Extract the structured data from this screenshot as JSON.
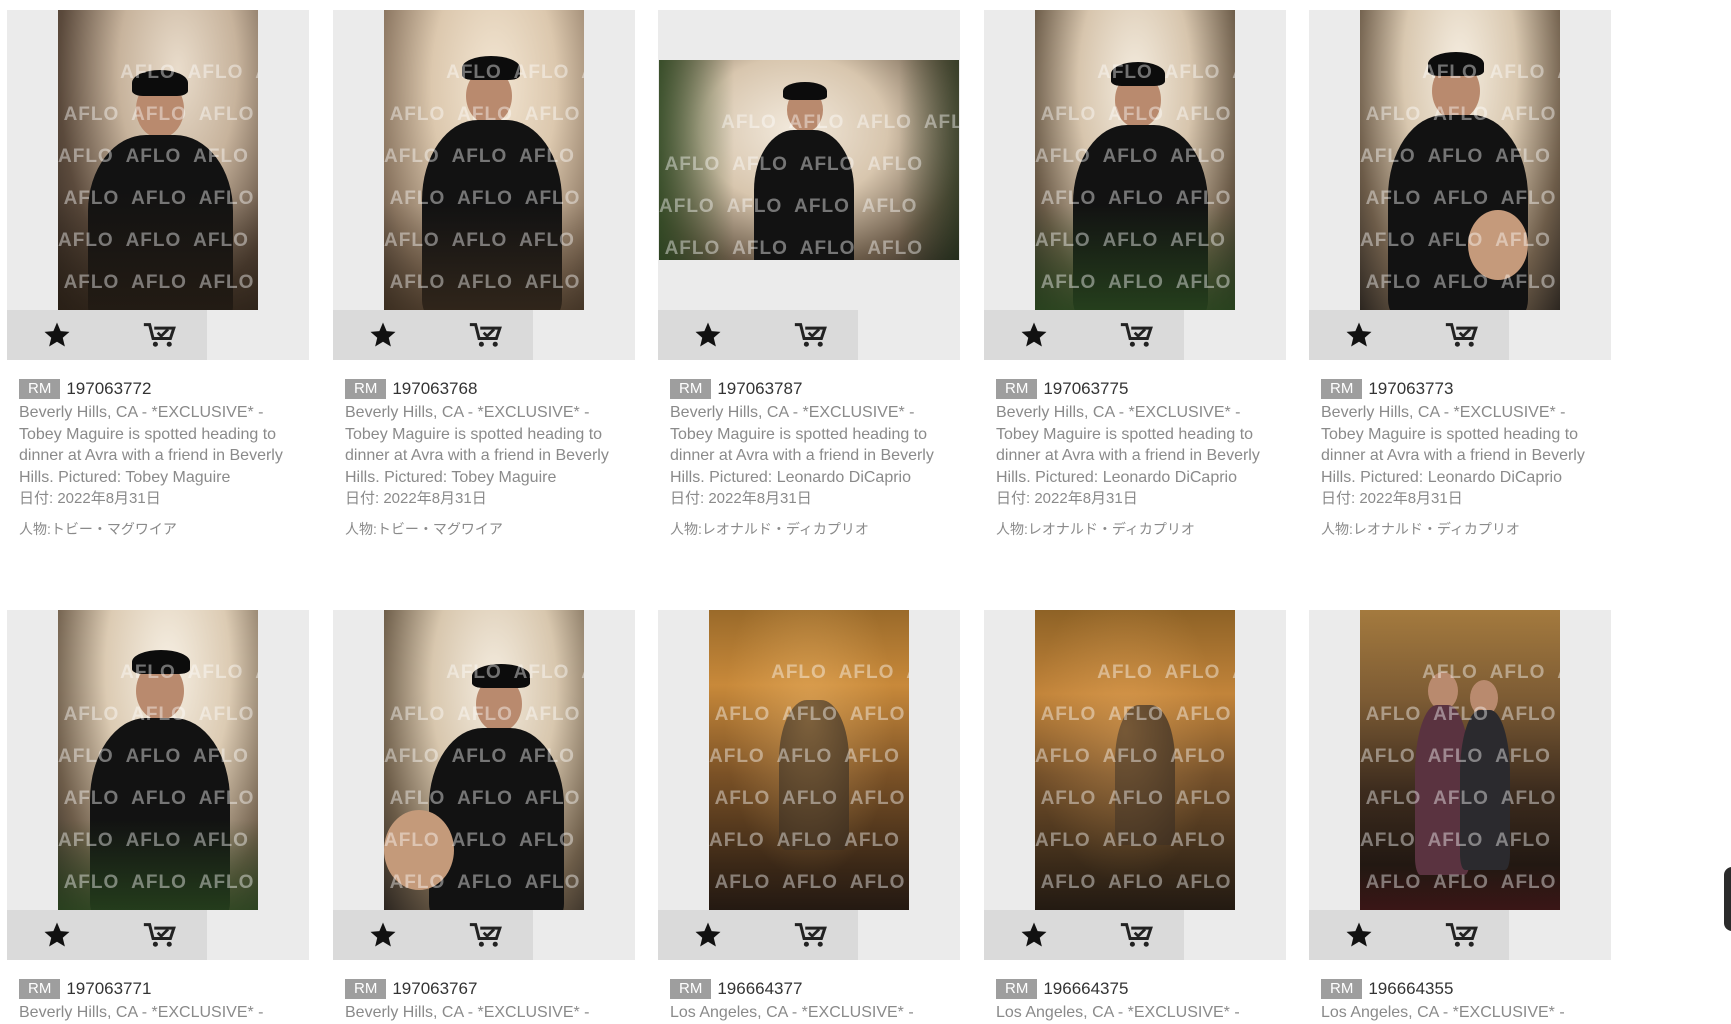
{
  "ui": {
    "badge_label": "RM",
    "colors": {
      "badge_bg": "#9e9e9e",
      "tile_bg": "#ebebeb",
      "action_bar_bg": "#dadada",
      "meta_text": "#8a8a8a",
      "id_text": "#333333"
    },
    "icons": {
      "favorite": "star-icon",
      "cart": "cart-icon"
    }
  },
  "results": [
    {
      "id": "197063772",
      "description": "Beverly Hills, CA - *EXCLUSIVE* - Tobey Maguire is spotted heading to dinner at Avra with a friend in Beverly Hills. Pictured: Tobey Maguire",
      "date": "日付: 2022年8月31日",
      "person": "人物:トビー・マグワイア",
      "watermark": "AFLO"
    },
    {
      "id": "197063768",
      "description": "Beverly Hills, CA - *EXCLUSIVE* - Tobey Maguire is spotted heading to dinner at Avra with a friend in Beverly Hills. Pictured: Tobey Maguire",
      "date": "日付: 2022年8月31日",
      "person": "人物:トビー・マグワイア",
      "watermark": "AFLO"
    },
    {
      "id": "197063787",
      "description": "Beverly Hills, CA - *EXCLUSIVE* - Tobey Maguire is spotted heading to dinner at Avra with a friend in Beverly Hills. Pictured: Leonardo DiCaprio",
      "date": "日付: 2022年8月31日",
      "person": "人物:レオナルド・ディカプリオ",
      "watermark": "AFLO"
    },
    {
      "id": "197063775",
      "description": "Beverly Hills, CA - *EXCLUSIVE* - Tobey Maguire is spotted heading to dinner at Avra with a friend in Beverly Hills. Pictured: Leonardo DiCaprio",
      "date": "日付: 2022年8月31日",
      "person": "人物:レオナルド・ディカプリオ",
      "watermark": "AFLO"
    },
    {
      "id": "197063773",
      "description": "Beverly Hills, CA - *EXCLUSIVE* - Tobey Maguire is spotted heading to dinner at Avra with a friend in Beverly Hills. Pictured: Leonardo DiCaprio",
      "date": "日付: 2022年8月31日",
      "person": "人物:レオナルド・ディカプリオ",
      "watermark": "AFLO"
    },
    {
      "id": "197063771",
      "description": "Beverly Hills, CA - *EXCLUSIVE* -",
      "date": "",
      "person": "",
      "watermark": "AFLO"
    },
    {
      "id": "197063767",
      "description": "Beverly Hills, CA - *EXCLUSIVE* -",
      "date": "",
      "person": "",
      "watermark": "AFLO"
    },
    {
      "id": "196664377",
      "description": "Los Angeles, CA - *EXCLUSIVE* -",
      "date": "",
      "person": "",
      "watermark": "AFLO"
    },
    {
      "id": "196664375",
      "description": "Los Angeles, CA - *EXCLUSIVE* -",
      "date": "",
      "person": "",
      "watermark": "AFLO"
    },
    {
      "id": "196664355",
      "description": "Los Angeles, CA - *EXCLUSIVE* -",
      "date": "",
      "person": "",
      "watermark": "AFLO"
    }
  ]
}
